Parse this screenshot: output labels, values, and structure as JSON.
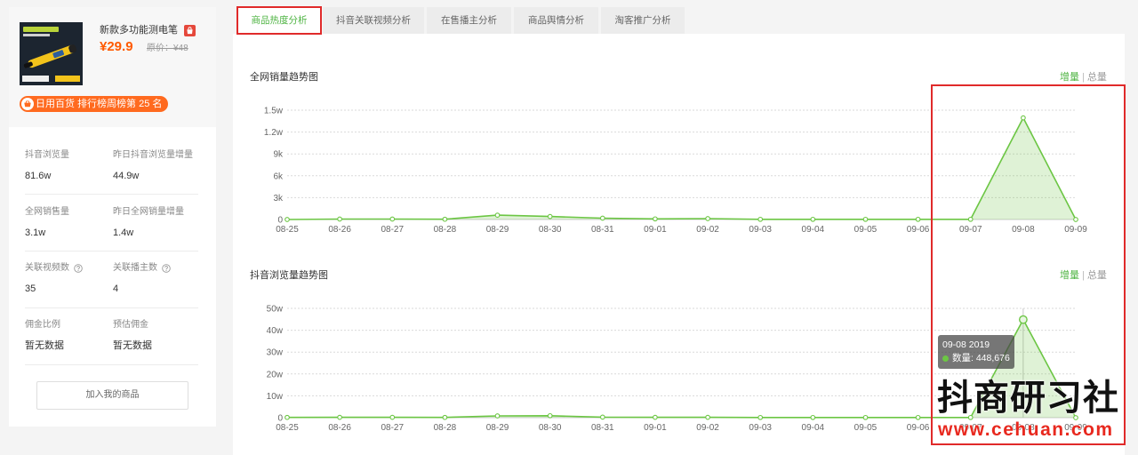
{
  "product": {
    "title": "新款多功能测电笔",
    "price": "¥29.9",
    "original_price": "原价：¥48",
    "rank_badge": "日用百货 排行榜周榜第 25 名"
  },
  "stats": [
    {
      "label": "抖音浏览量",
      "value": "81.6w"
    },
    {
      "label": "昨日抖音浏览量增量",
      "value": "44.9w"
    },
    {
      "label": "全网销售量",
      "value": "3.1w"
    },
    {
      "label": "昨日全网销量增量",
      "value": "1.4w"
    },
    {
      "label": "关联视频数",
      "value": "35",
      "has_help": true
    },
    {
      "label": "关联播主数",
      "value": "4",
      "has_help": true
    },
    {
      "label": "佣金比例",
      "value": "暂无数据"
    },
    {
      "label": "预估佣金",
      "value": "暂无数据"
    }
  ],
  "add_button": "加入我的商品",
  "tabs": [
    {
      "label": "商品热度分析",
      "active": true
    },
    {
      "label": "抖音关联视频分析",
      "active": false
    },
    {
      "label": "在售播主分析",
      "active": false
    },
    {
      "label": "商品舆情分析",
      "active": false
    },
    {
      "label": "淘客推广分析",
      "active": false
    }
  ],
  "toggle": {
    "options": [
      "增量",
      "总量"
    ],
    "separator": "|",
    "selected_index": 0
  },
  "watermark": {
    "brand": "抖商研习社",
    "url": "www.cehuan.com"
  },
  "icons": {
    "store": "store-icon",
    "rank_badge": "basket-icon",
    "help": "question-circle-icon"
  },
  "colors": {
    "accent_green": "#4fb443",
    "series_line": "#6cc644",
    "series_fill": "rgba(108,198,68,0.22)",
    "price": "#ff5a00",
    "badge": "#ff6a1f",
    "annotation": "#e02a2a",
    "watermark_url": "#e8291f"
  },
  "chart_data": [
    {
      "type": "area",
      "title": "全网销量趋势图",
      "x": [
        "08-25",
        "08-26",
        "08-27",
        "08-28",
        "08-29",
        "08-30",
        "08-31",
        "09-01",
        "09-02",
        "09-03",
        "09-04",
        "09-05",
        "09-06",
        "09-07",
        "09-08",
        "09-09"
      ],
      "values": [
        0,
        60,
        60,
        40,
        600,
        420,
        180,
        90,
        120,
        30,
        30,
        30,
        20,
        30,
        13950,
        0
      ],
      "ylim": [
        0,
        15000
      ],
      "yticks": [
        0,
        3000,
        6000,
        9000,
        12000,
        15000
      ],
      "ytick_labels": [
        "0",
        "3k",
        "6k",
        "9k",
        "1.2w",
        "1.5w"
      ],
      "grid": true
    },
    {
      "type": "area",
      "title": "抖音浏览量趋势图",
      "x": [
        "08-25",
        "08-26",
        "08-27",
        "08-28",
        "08-29",
        "08-30",
        "08-31",
        "09-01",
        "09-02",
        "09-03",
        "09-04",
        "09-05",
        "09-06",
        "09-07",
        "09-08",
        "09-09"
      ],
      "values": [
        1200,
        1500,
        1500,
        1200,
        8000,
        9000,
        2500,
        1800,
        1600,
        900,
        900,
        800,
        700,
        1000,
        448676,
        0
      ],
      "ylim": [
        0,
        500000
      ],
      "yticks": [
        0,
        100000,
        200000,
        300000,
        400000,
        500000
      ],
      "ytick_labels": [
        "0",
        "10w",
        "20w",
        "30w",
        "40w",
        "50w"
      ],
      "grid": true,
      "tooltip": {
        "title": "09-08 2019",
        "text": "数量: 448,676",
        "hovered_index": 14
      }
    }
  ]
}
